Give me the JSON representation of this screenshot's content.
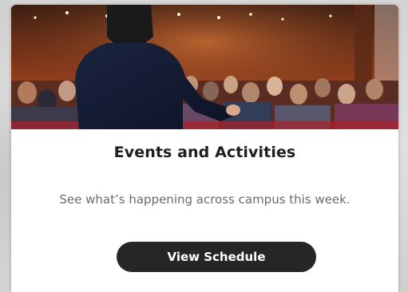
{
  "card": {
    "title": "Events and Activities",
    "description": "See what’s happening across campus this week.",
    "button_label": "View Schedule"
  },
  "colors": {
    "button_bg": "#262626",
    "title": "#1e1e1e",
    "description": "#6b6b6b"
  },
  "image": {
    "subject": "speaker-at-conference-photo"
  }
}
